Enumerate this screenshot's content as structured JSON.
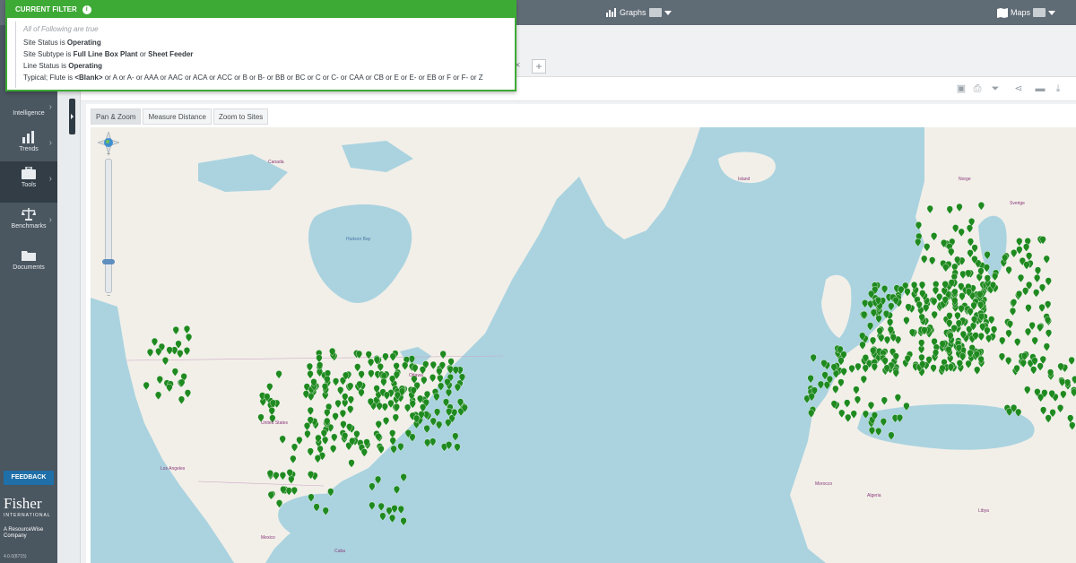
{
  "topbar": {
    "graphs_label": "Graphs",
    "maps_label": "Maps"
  },
  "sidebar": {
    "items": [
      {
        "label": "Intelligence",
        "icon": "intelligence-icon"
      },
      {
        "label": "Trends",
        "icon": "bar-chart-icon"
      },
      {
        "label": "Tools",
        "icon": "briefcase-icon",
        "active": true
      },
      {
        "label": "Benchmarks",
        "icon": "scales-icon"
      },
      {
        "label": "Documents",
        "icon": "folder-icon"
      }
    ],
    "feedback_label": "FEEDBACK",
    "logo_name": "Fisher",
    "logo_subname": "INTERNATIONAL",
    "logo_parent": "A ResourceWise Company",
    "version": "4.0.0(8715)"
  },
  "filter": {
    "title": "CURRENT FILTER",
    "intro": "All of Following are true",
    "rules": [
      {
        "prefix": "Site Status is ",
        "value": "Operating",
        "suffix": ""
      },
      {
        "prefix": "Site Subtype is ",
        "value": "Full Line Box Plant",
        "suffix": " or ",
        "value2": "Sheet Feeder"
      },
      {
        "prefix": "Line Status is ",
        "value": "Operating",
        "suffix": ""
      },
      {
        "prefix": "Typical; Flute is ",
        "value": "<Blank>",
        "suffix": " or A or A- or AAA or AAC or ACA or ACC or B or B- or BB or BC or C or C- or CAA or CB or E or E- or EB or F or F- or Z"
      }
    ]
  },
  "map_tools": {
    "tabs": [
      "Pan & Zoom",
      "Measure Distance",
      "Zoom to Sites"
    ],
    "active_tab": 0
  },
  "map": {
    "labels": [
      {
        "text": "Canada",
        "type": "country"
      },
      {
        "text": "United States",
        "type": "country"
      },
      {
        "text": "Mexico",
        "type": "country"
      },
      {
        "text": "Cuba",
        "type": "country"
      },
      {
        "text": "Island",
        "type": "country"
      },
      {
        "text": "Sverige",
        "type": "country"
      },
      {
        "text": "Norge",
        "type": "country"
      },
      {
        "text": "Hudson Bay",
        "type": "water"
      },
      {
        "text": "Ottawa",
        "type": "city"
      },
      {
        "text": "Los Angeles",
        "type": "city"
      },
      {
        "text": "Morocco",
        "type": "country"
      },
      {
        "text": "Algeria",
        "type": "country"
      },
      {
        "text": "Libya",
        "type": "country"
      }
    ],
    "marker_color": "#1f8a1f",
    "land_color": "#f2efe9",
    "water_color": "#aad3df"
  },
  "colors": {
    "accent": "#3daa35",
    "topbar": "#5f6b75",
    "sidebar": "#4a5660",
    "feedback": "#1f6fa8"
  }
}
